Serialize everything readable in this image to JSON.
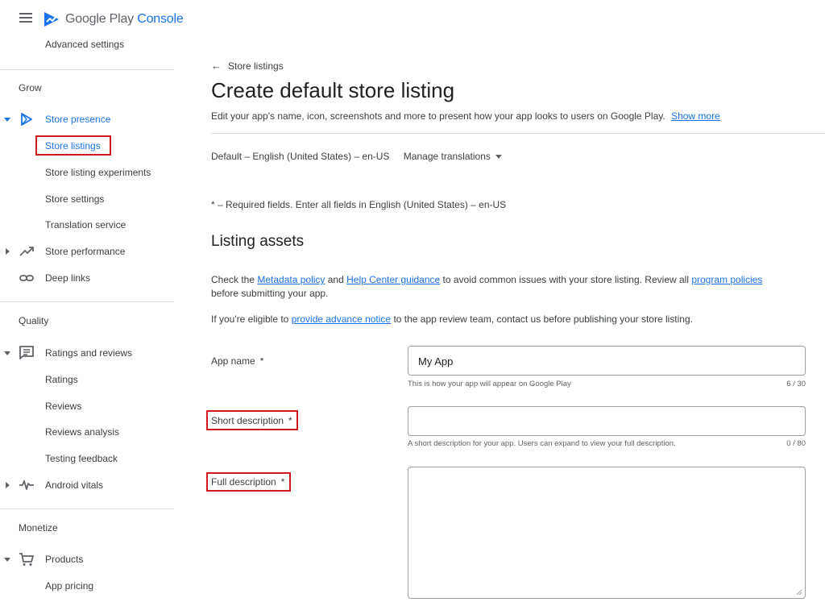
{
  "app": {
    "brand_part1": "Google Play",
    "brand_part2": "Console"
  },
  "sidebar": {
    "advanced_settings": "Advanced settings",
    "grow_label": "Grow",
    "store_presence": "Store presence",
    "store_listings": "Store listings",
    "store_listing_experiments": "Store listing experiments",
    "store_settings": "Store settings",
    "translation_service": "Translation service",
    "store_performance": "Store performance",
    "deep_links": "Deep links",
    "quality_label": "Quality",
    "ratings_and_reviews": "Ratings and reviews",
    "ratings": "Ratings",
    "reviews": "Reviews",
    "reviews_analysis": "Reviews analysis",
    "testing_feedback": "Testing feedback",
    "android_vitals": "Android vitals",
    "monetize_label": "Monetize",
    "products": "Products",
    "app_pricing": "App pricing"
  },
  "main": {
    "back_label": "Store listings",
    "title": "Create default store listing",
    "subtitle": "Edit your app's name, icon, screenshots and more to present how your app looks to users on Google Play.",
    "show_more": "Show more",
    "language": "Default – English (United States) – en-US",
    "manage_translations": "Manage translations",
    "required_note": "* – Required fields. Enter all fields in English (United States) – en-US",
    "section_title": "Listing assets",
    "para1": {
      "t1": "Check the ",
      "link1": "Metadata policy",
      "t2": " and ",
      "link2": "Help Center guidance",
      "t3": " to avoid common issues with your store listing. Review all ",
      "link3": "program policies",
      "t4": " before submitting your app."
    },
    "para2": {
      "t1": "If you're eligible to ",
      "link1": "provide advance notice",
      "t2": " to the app review team, contact us before publishing your store listing."
    },
    "fields": {
      "app_name": {
        "label": "App name",
        "star": "*",
        "value": "My App",
        "hint": "This is how your app will appear on Google Play",
        "counter": "6 / 30"
      },
      "short_description": {
        "label": "Short description",
        "star": "*",
        "value": "",
        "hint": "A short description for your app. Users can expand to view your full description.",
        "counter": "0 / 80"
      },
      "full_description": {
        "label": "Full description",
        "star": "*",
        "value": ""
      }
    }
  },
  "colors": {
    "accent": "#1a73e8",
    "highlight": "#d0161e",
    "text": "#3c4043"
  }
}
